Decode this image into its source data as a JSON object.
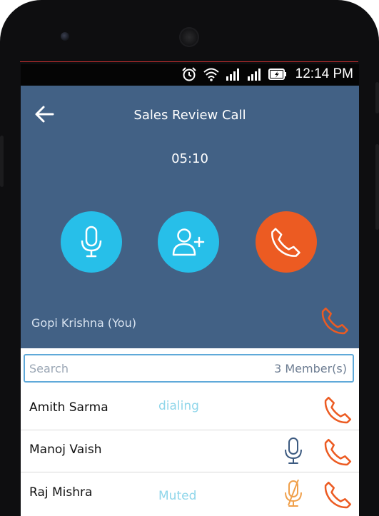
{
  "status_bar": {
    "time": "12:14 PM",
    "icons": [
      "alarm-icon",
      "wifi-icon",
      "signal-icon",
      "signal-icon",
      "battery-charging-icon"
    ]
  },
  "call": {
    "title": "Sales Review Call",
    "timer": "05:10",
    "self_name": "Gopi Krishna  (You)"
  },
  "search": {
    "placeholder": "Search",
    "member_count": "3 Member(s)"
  },
  "members": [
    {
      "name": "Amith Sarma",
      "status": "dialing",
      "mic": "none"
    },
    {
      "name": "Manoj Vaish",
      "status": "",
      "mic": "on"
    },
    {
      "name": "Raj Mishra",
      "status": "Muted",
      "mic": "muted"
    }
  ],
  "colors": {
    "panel": "#426185",
    "action_blue": "#27bfe9",
    "end_call_orange": "#ec5b22",
    "status_text": "#8fd6ea"
  }
}
